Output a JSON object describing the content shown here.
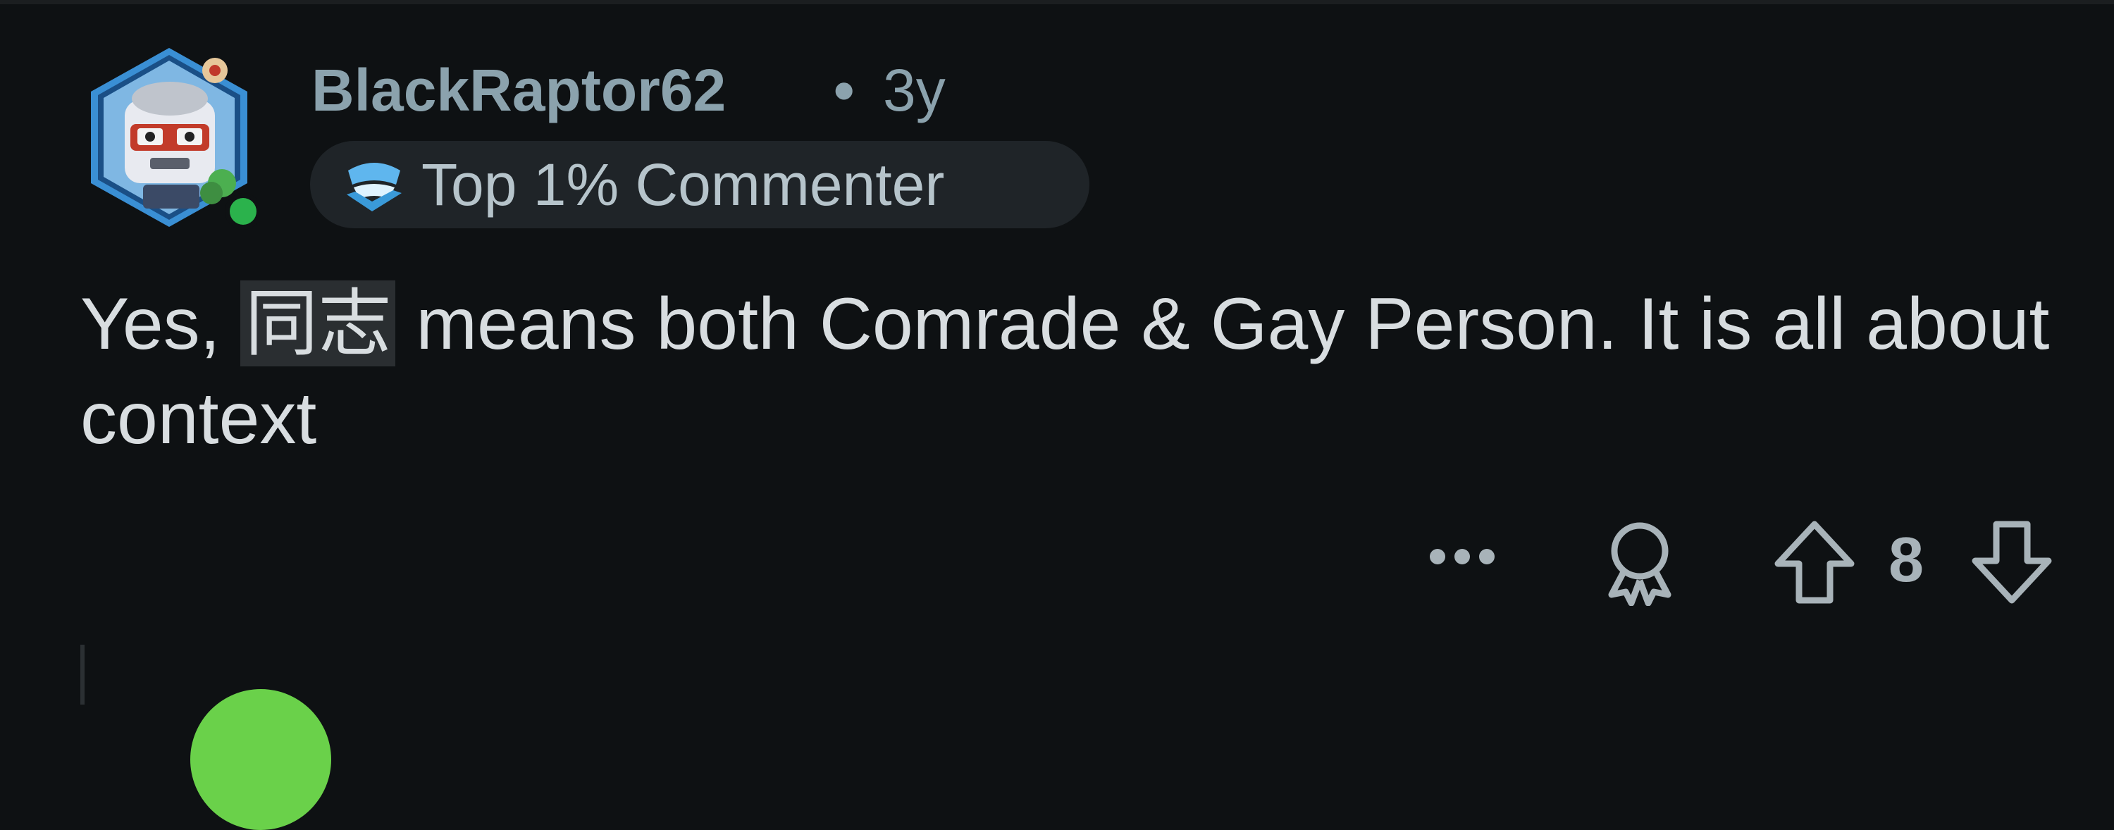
{
  "comment": {
    "username": "BlackRaptor62",
    "separator": "•",
    "age": "3y",
    "flair": {
      "icon": "commenter-badge-icon",
      "label": "Top 1% Commenter"
    },
    "online_status": "online",
    "body": {
      "before": "Yes, ",
      "highlight": "同志",
      "after": " means both Comrade & Gay Person. It is all about context"
    },
    "actions": {
      "more_icon": "more-horizontal-icon",
      "award_icon": "award-icon",
      "upvote_icon": "arrow-up-icon",
      "score": "8",
      "downvote_icon": "arrow-down-icon"
    }
  },
  "colors": {
    "background": "#0e1113",
    "meta_text": "#8ba2ad",
    "body_text": "#d8dde0",
    "flair_bg": "#1f2428",
    "online_dot": "#2bb24c",
    "next_avatar": "#6ad14a"
  }
}
